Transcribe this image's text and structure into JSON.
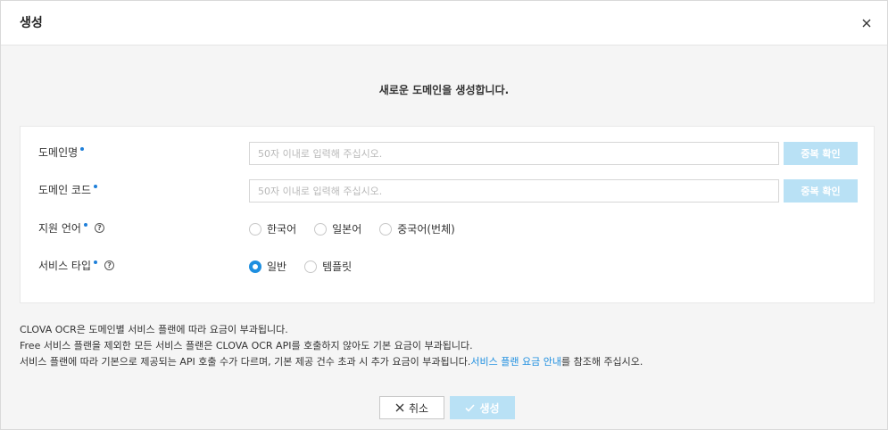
{
  "dialog": {
    "title": "생성",
    "close_icon": "close-icon"
  },
  "intro_text": "새로운 도메인을 생성합니다.",
  "form": {
    "domain_name": {
      "label": "도메인명",
      "placeholder": "50자 이내로 입력해 주십시오.",
      "value": "",
      "check_button": "중복 확인"
    },
    "domain_code": {
      "label": "도메인 코드",
      "placeholder": "50자 이내로 입력해 주십시오.",
      "value": "",
      "check_button": "중복 확인"
    },
    "language": {
      "label": "지원 언어",
      "options": [
        "한국어",
        "일본어",
        "중국어(번체)"
      ],
      "selected": null
    },
    "service_type": {
      "label": "서비스 타입",
      "options": [
        "일반",
        "템플릿"
      ],
      "selected": "일반"
    }
  },
  "notes": {
    "line1": "CLOVA OCR은 도메인별 서비스 플랜에 따라 요금이 부과됩니다.",
    "line2": "Free 서비스 플랜을 제외한 모든 서비스 플랜은 CLOVA OCR API를 호출하지 않아도 기본 요금이 부과됩니다.",
    "line3_prefix": "서비스 플랜에 따라 기본으로 제공되는 API 호출 수가 다르며, 기본 제공 건수 초과 시 추가 요금이 부과됩니다.",
    "line3_link": "서비스 플랜 요금 안내",
    "line3_suffix": "를 참조해 주십시오."
  },
  "buttons": {
    "cancel": "취소",
    "create": "생성"
  },
  "colors": {
    "accent": "#1e8fe0",
    "disabled_button": "#b9e1f5",
    "required_dot": "#1e7fd9"
  }
}
